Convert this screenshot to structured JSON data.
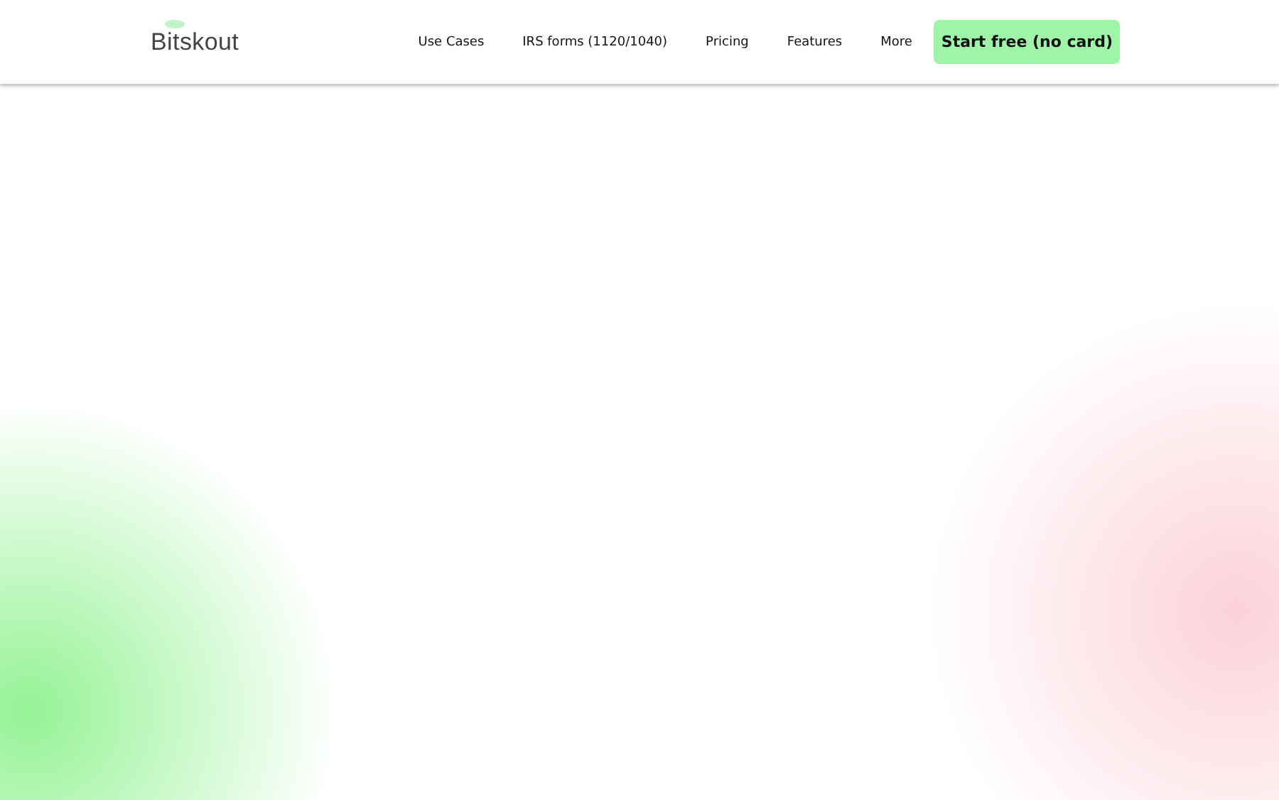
{
  "header": {
    "logo": "Bitskout",
    "nav": [
      {
        "label": "Use Cases"
      },
      {
        "label": "IRS forms (1120/1040)"
      },
      {
        "label": "Pricing"
      },
      {
        "label": "Features"
      },
      {
        "label": "More"
      }
    ],
    "cta": "Start free (no card)"
  }
}
